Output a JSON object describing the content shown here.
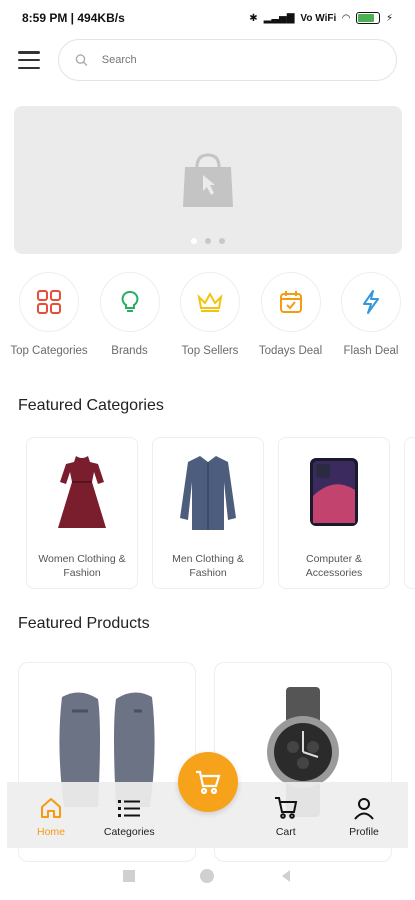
{
  "status": {
    "time_speed": "8:59 PM | 494KB/s",
    "network": "Vo WiFi"
  },
  "search": {
    "placeholder": "Search"
  },
  "banner": {
    "dots": 3,
    "active_dot": 0
  },
  "quick": [
    {
      "label": "Top Categories",
      "icon": "grid-icon",
      "color": "#e74c3c"
    },
    {
      "label": "Brands",
      "icon": "lightbulb-icon",
      "color": "#27ae60"
    },
    {
      "label": "Top Sellers",
      "icon": "crown-icon",
      "color": "#f1c40f"
    },
    {
      "label": "Todays Deal",
      "icon": "calendar-icon",
      "color": "#f39c12"
    },
    {
      "label": "Flash Deal",
      "icon": "lightning-icon",
      "color": "#3498db"
    }
  ],
  "featured_categories": {
    "title": "Featured Categories",
    "items": [
      {
        "label": "Women Clothing & Fashion"
      },
      {
        "label": "Men Clothing & Fashion"
      },
      {
        "label": "Computer & Accessories"
      }
    ]
  },
  "featured_products": {
    "title": "Featured Products"
  },
  "bottom_nav": {
    "home": "Home",
    "categories": "Categories",
    "cart": "Cart",
    "profile": "Profile",
    "accent": "#f39c12"
  }
}
